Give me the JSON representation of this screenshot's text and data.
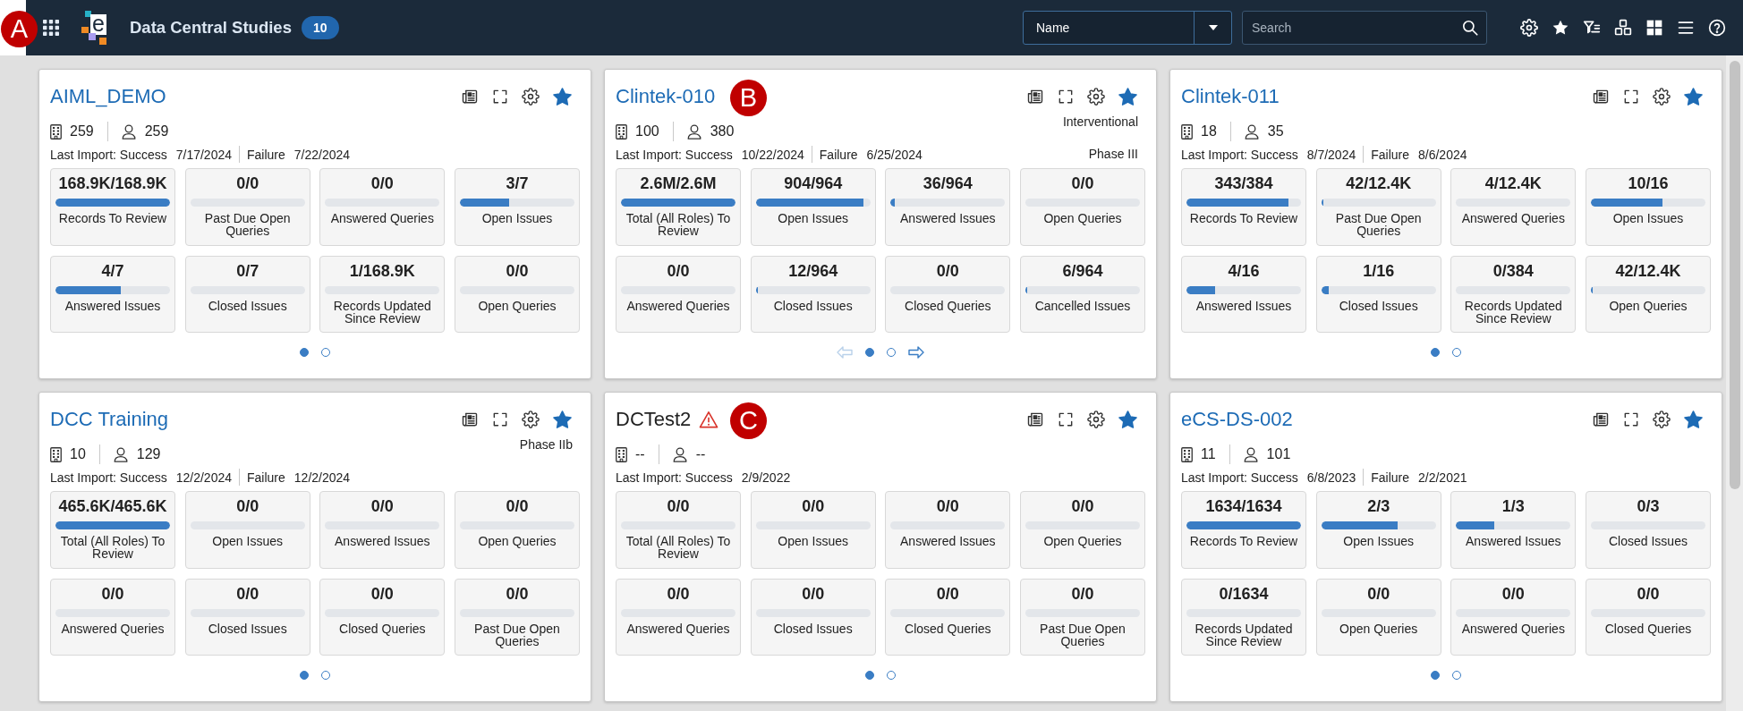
{
  "header": {
    "callout": "A",
    "logo_letter": "e",
    "title": "Data Central Studies",
    "count_badge": "10",
    "sort_dropdown": {
      "value": "Name"
    },
    "search": {
      "placeholder": "Search"
    }
  },
  "studies": [
    {
      "title": "AIML_DEMO",
      "linked": true,
      "warning": false,
      "favorite": true,
      "sites": "259",
      "subjects": "259",
      "last_import": {
        "status": "Last Import: Success",
        "date": "7/17/2024",
        "failure_label": "Failure",
        "failure_date": "7/22/2024"
      },
      "metrics": [
        {
          "value": "168.9K/168.9K",
          "level": 1,
          "label": "Records To Review"
        },
        {
          "value": "0/0",
          "label": "Past Due Open Queries"
        },
        {
          "value": "0/0",
          "label": "Answered Queries"
        },
        {
          "value": "3/7",
          "level": 0.43,
          "label": "Open Issues"
        },
        {
          "value": "4/7",
          "level": 0.57,
          "label": "Answered Issues"
        },
        {
          "value": "0/7",
          "label": "Closed Issues"
        },
        {
          "value": "1/168.9K",
          "label": "Records Updated Since Review"
        },
        {
          "value": "0/0",
          "label": "Open Queries"
        }
      ],
      "pages": [
        {
          "selected": true
        },
        {
          "selected": false
        }
      ]
    },
    {
      "title": "Clintek-010",
      "callout": "B",
      "linked": true,
      "warning": false,
      "favorite": true,
      "study_type": "Interventional",
      "phase": "Phase III",
      "sites": "100",
      "subjects": "380",
      "last_import": {
        "status": "Last Import: Success",
        "date": "10/22/2024",
        "failure_label": "Failure",
        "failure_date": "6/25/2024"
      },
      "metrics": [
        {
          "value": "2.6M/2.6M",
          "level": 1,
          "label": "Total (All Roles) To Review"
        },
        {
          "value": "904/964",
          "level": 0.94,
          "label": "Open Issues"
        },
        {
          "value": "36/964",
          "level": 0.04,
          "label": "Answered Issues"
        },
        {
          "value": "0/0",
          "label": "Open Queries"
        },
        {
          "value": "0/0",
          "label": "Answered Queries"
        },
        {
          "value": "12/964",
          "level": 0.015,
          "label": "Closed Issues"
        },
        {
          "value": "0/0",
          "label": "Closed Queries"
        },
        {
          "value": "6/964",
          "level": 0.015,
          "label": "Cancelled Issues"
        }
      ],
      "pages": [
        {
          "selected": true
        },
        {
          "selected": false
        }
      ],
      "pager_arrows": {
        "prev_disabled": true,
        "next_disabled": false
      }
    },
    {
      "title": "Clintek-011",
      "linked": true,
      "warning": false,
      "favorite": true,
      "sites": "18",
      "subjects": "35",
      "last_import": {
        "status": "Last Import: Success",
        "date": "8/7/2024",
        "failure_label": "Failure",
        "failure_date": "8/6/2024"
      },
      "metrics": [
        {
          "value": "343/384",
          "level": 0.89,
          "label": "Records To Review"
        },
        {
          "value": "42/12.4K",
          "level": 0.015,
          "label": "Past Due Open Queries"
        },
        {
          "value": "4/12.4K",
          "label": "Answered Queries"
        },
        {
          "value": "10/16",
          "level": 0.625,
          "label": "Open Issues"
        },
        {
          "value": "4/16",
          "level": 0.25,
          "label": "Answered Issues"
        },
        {
          "value": "1/16",
          "level": 0.0625,
          "label": "Closed Issues"
        },
        {
          "value": "0/384",
          "label": "Records Updated Since Review"
        },
        {
          "value": "42/12.4K",
          "level": 0.015,
          "label": "Open Queries"
        }
      ],
      "pages": [
        {
          "selected": true
        },
        {
          "selected": false
        }
      ]
    },
    {
      "title": "DCC Training",
      "linked": true,
      "warning": false,
      "favorite": true,
      "phase": "Phase IIb",
      "sites": "10",
      "subjects": "129",
      "last_import": {
        "status": "Last Import: Success",
        "date": "12/2/2024",
        "failure_label": "Failure",
        "failure_date": "12/2/2024"
      },
      "metrics": [
        {
          "value": "465.6K/465.6K",
          "level": 1,
          "label": "Total (All Roles) To Review"
        },
        {
          "value": "0/0",
          "label": "Open Issues"
        },
        {
          "value": "0/0",
          "label": "Answered Issues"
        },
        {
          "value": "0/0",
          "label": "Open Queries"
        },
        {
          "value": "0/0",
          "label": "Answered Queries"
        },
        {
          "value": "0/0",
          "label": "Closed Issues"
        },
        {
          "value": "0/0",
          "label": "Closed Queries"
        },
        {
          "value": "0/0",
          "label": "Past Due Open Queries"
        }
      ],
      "pages": [
        {
          "selected": true
        },
        {
          "selected": false
        }
      ]
    },
    {
      "title": "DCTest2",
      "callout": "C",
      "linked": false,
      "warning": true,
      "favorite": true,
      "sites": "--",
      "subjects": "--",
      "last_import": {
        "status": "Last Import: Success",
        "date": "2/9/2022"
      },
      "metrics": [
        {
          "value": "0/0",
          "label": "Total (All Roles) To Review"
        },
        {
          "value": "0/0",
          "label": "Open Issues"
        },
        {
          "value": "0/0",
          "label": "Answered Issues"
        },
        {
          "value": "0/0",
          "label": "Open Queries"
        },
        {
          "value": "0/0",
          "label": "Answered Queries"
        },
        {
          "value": "0/0",
          "label": "Closed Issues"
        },
        {
          "value": "0/0",
          "label": "Closed Queries"
        },
        {
          "value": "0/0",
          "label": "Past Due Open Queries"
        }
      ],
      "pages": [
        {
          "selected": true
        },
        {
          "selected": false
        }
      ]
    },
    {
      "title": "eCS-DS-002",
      "linked": true,
      "warning": false,
      "favorite": true,
      "sites": "11",
      "subjects": "101",
      "last_import": {
        "status": "Last Import: Success",
        "date": "6/8/2023",
        "failure_label": "Failure",
        "failure_date": "2/2/2021"
      },
      "metrics": [
        {
          "value": "1634/1634",
          "level": 1,
          "label": "Records To Review"
        },
        {
          "value": "2/3",
          "level": 0.67,
          "label": "Open Issues"
        },
        {
          "value": "1/3",
          "level": 0.33,
          "label": "Answered Issues"
        },
        {
          "value": "0/3",
          "label": "Closed Issues"
        },
        {
          "value": "0/1634",
          "label": "Records Updated Since Review"
        },
        {
          "value": "0/0",
          "label": "Open Queries"
        },
        {
          "value": "0/0",
          "label": "Answered Queries"
        },
        {
          "value": "0/0",
          "label": "Closed Queries"
        }
      ],
      "pages": [
        {
          "selected": true
        },
        {
          "selected": false
        }
      ]
    }
  ]
}
